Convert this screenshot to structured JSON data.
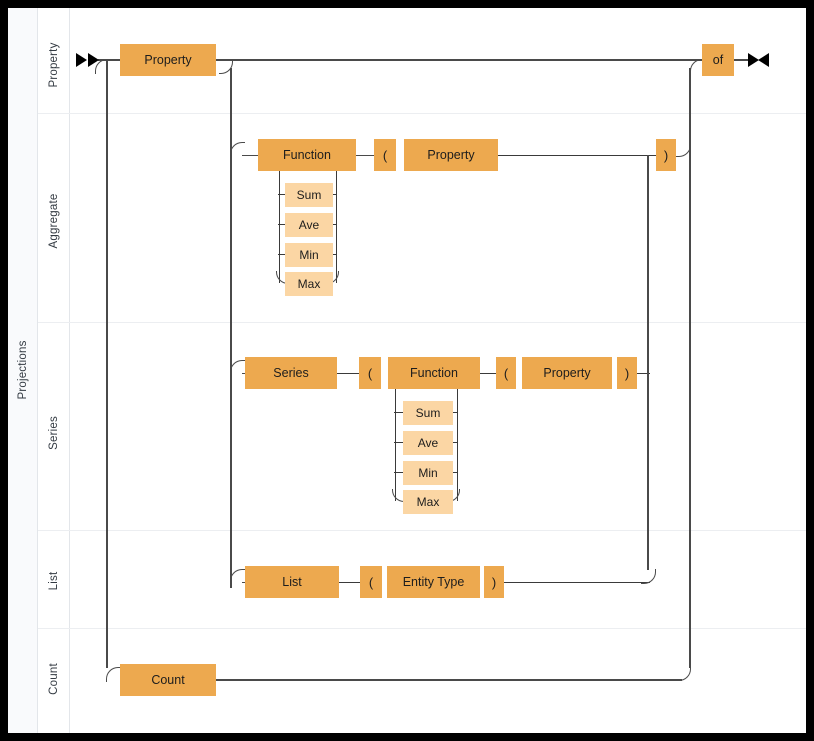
{
  "diagram": {
    "type": "railroad-syntax-diagram",
    "title": "Projections",
    "colors": {
      "node_fill": "#eda94f",
      "node_alt_fill": "#fbd6a4",
      "line": "#4a4a4a",
      "frame": "#000000",
      "canvas": "#ffffff",
      "lane_header_fill": "#f9fafc",
      "lane_divider": "#eceef1"
    },
    "group_label": "Projections",
    "lanes": [
      {
        "label": "Property"
      },
      {
        "label": "Aggregate"
      },
      {
        "label": "Series"
      },
      {
        "label": "List"
      },
      {
        "label": "Count"
      }
    ],
    "markers": {
      "start": "start-marker",
      "end": "end-marker"
    },
    "nodes": {
      "property_main": "Property",
      "of": "of",
      "aggregate_function": "Function",
      "aggregate_open_paren": "(",
      "aggregate_property": "Property",
      "aggregate_close_paren": ")",
      "aggregate_options": [
        "Sum",
        "Ave",
        "Min",
        "Max"
      ],
      "series": "Series",
      "series_open_paren": "(",
      "series_function": "Function",
      "series_inner_open_paren": "(",
      "series_property": "Property",
      "series_close_paren": ")",
      "series_options": [
        "Sum",
        "Ave",
        "Min",
        "Max"
      ],
      "list": "List",
      "list_open_paren": "(",
      "list_entity_type": "Entity Type",
      "list_close_paren": ")",
      "count": "Count"
    }
  }
}
